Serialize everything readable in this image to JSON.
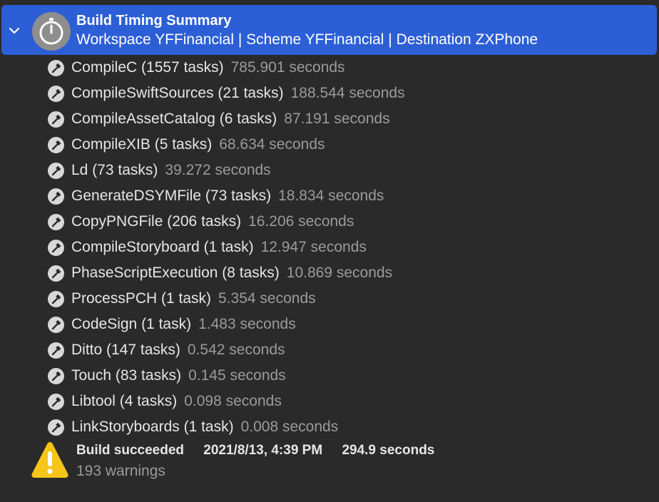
{
  "header": {
    "title": "Build Timing Summary",
    "subtitle": "Workspace YFFinancial | Scheme YFFinancial | Destination ZXPhone",
    "icon": "stopwatch-icon",
    "disclosure_icon": "chevron-down-icon",
    "accent_color": "#2c5fd6"
  },
  "tasks": [
    {
      "name": "CompileC (1557 tasks)",
      "time": "785.901 seconds"
    },
    {
      "name": "CompileSwiftSources (21 tasks)",
      "time": "188.544 seconds"
    },
    {
      "name": "CompileAssetCatalog (6 tasks)",
      "time": "87.191 seconds"
    },
    {
      "name": "CompileXIB (5 tasks)",
      "time": "68.634 seconds"
    },
    {
      "name": "Ld (73 tasks)",
      "time": "39.272 seconds"
    },
    {
      "name": "GenerateDSYMFile (73 tasks)",
      "time": "18.834 seconds"
    },
    {
      "name": "CopyPNGFile (206 tasks)",
      "time": "16.206 seconds"
    },
    {
      "name": "CompileStoryboard (1 task)",
      "time": "12.947 seconds"
    },
    {
      "name": "PhaseScriptExecution (8 tasks)",
      "time": "10.869 seconds"
    },
    {
      "name": "ProcessPCH (1 task)",
      "time": "5.354 seconds"
    },
    {
      "name": "CodeSign (1 task)",
      "time": "1.483 seconds"
    },
    {
      "name": "Ditto (147 tasks)",
      "time": "0.542 seconds"
    },
    {
      "name": "Touch (83 tasks)",
      "time": "0.145 seconds"
    },
    {
      "name": "Libtool (4 tasks)",
      "time": "0.098 seconds"
    },
    {
      "name": "LinkStoryboards (1 task)",
      "time": "0.008 seconds"
    }
  ],
  "task_icon": "hammer-icon",
  "result": {
    "status": "Build succeeded",
    "timestamp": "2021/8/13, 4:39 PM",
    "duration": "294.9 seconds",
    "warnings": "193 warnings",
    "icon": "warning-icon",
    "warning_color": "#f5c518"
  }
}
